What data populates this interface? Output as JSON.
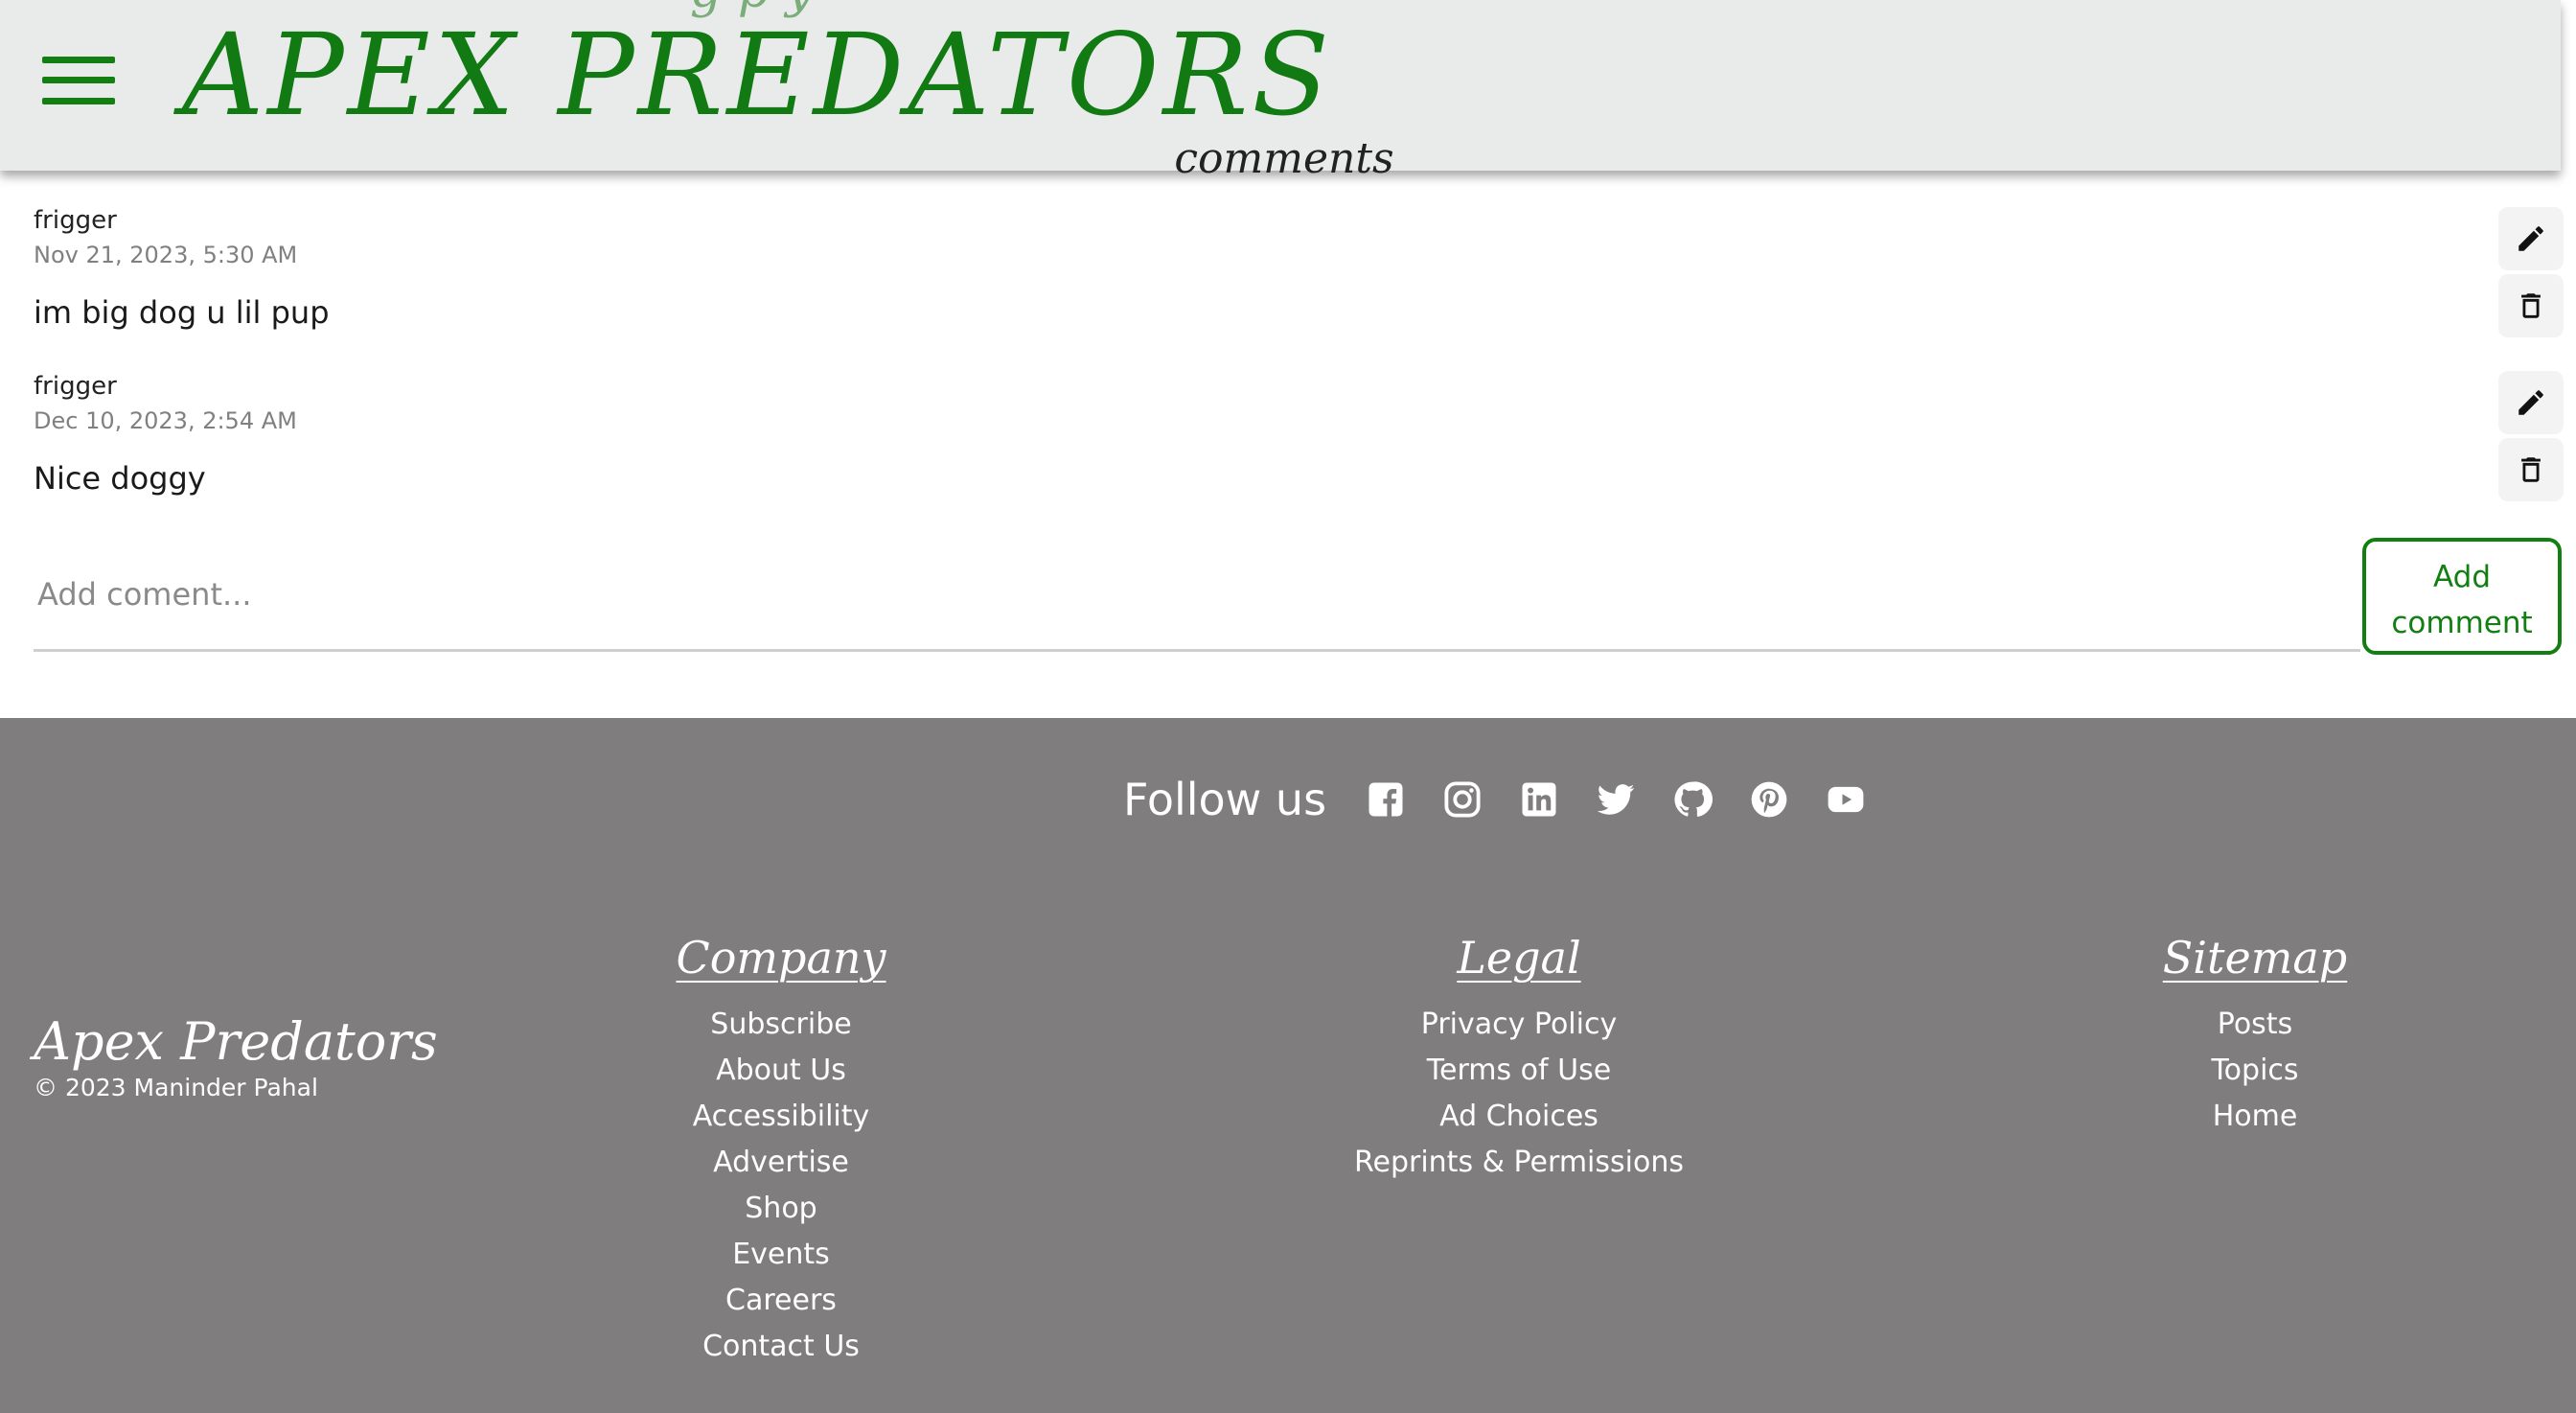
{
  "header": {
    "peek_text": "g p y",
    "title": "APEX PREDATORS",
    "menu_icon": "hamburger-menu-icon"
  },
  "comments_section": {
    "heading": "comments",
    "comments": [
      {
        "author": "frigger",
        "date": "Nov 21, 2023, 5:30 AM",
        "text": "im big dog u lil pup"
      },
      {
        "author": "frigger",
        "date": "Dec 10, 2023, 2:54 AM",
        "text": "Nice doggy"
      }
    ],
    "add_placeholder": "Add coment...",
    "add_button": "Add comment"
  },
  "footer": {
    "follow_label": "Follow us",
    "social_icons": [
      "facebook-icon",
      "instagram-icon",
      "linkedin-icon",
      "twitter-icon",
      "github-icon",
      "pinterest-icon",
      "youtube-icon"
    ],
    "brand_name": "Apex Predators",
    "copyright": "© 2023 Maninder Pahal",
    "columns": [
      {
        "title": "Company",
        "links": [
          "Subscribe",
          "About Us",
          "Accessibility",
          "Advertise",
          "Shop",
          "Events",
          "Careers",
          "Contact Us"
        ]
      },
      {
        "title": "Legal",
        "links": [
          "Privacy Policy",
          "Terms of Use",
          "Ad Choices",
          "Reprints & Permissions"
        ]
      },
      {
        "title": "Sitemap",
        "links": [
          "Posts",
          "Topics",
          "Home"
        ]
      }
    ]
  },
  "colors": {
    "brand_green": "#137f13",
    "footer_bg": "#7f7d7e",
    "header_bg": "#e9ebea"
  }
}
